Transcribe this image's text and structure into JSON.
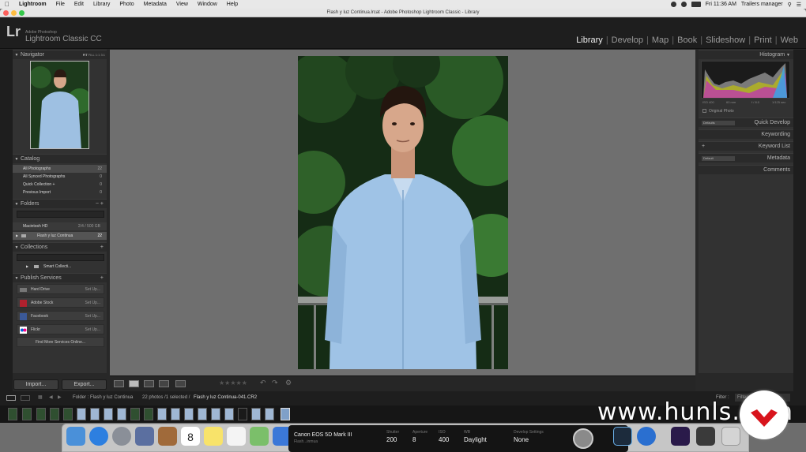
{
  "menubar": {
    "app": "Lightroom",
    "items": [
      "File",
      "Edit",
      "Library",
      "Photo",
      "Metadata",
      "View",
      "Window",
      "Help"
    ],
    "clock": "Fri 11:36 AM",
    "user": "Trailers manager"
  },
  "window": {
    "title": "Flash y luz Continua.lrcat - Adobe Photoshop Lightroom Classic - Library"
  },
  "identity": {
    "logo": "Lr",
    "sub1": "Adobe Photoshop",
    "sub2": "Lightroom Classic CC",
    "modules": [
      "Library",
      "Develop",
      "Map",
      "Book",
      "Slideshow",
      "Print",
      "Web"
    ],
    "active": "Library"
  },
  "left": {
    "navigator": {
      "title": "Navigator",
      "zoom": [
        "FIT",
        "FILL",
        "1:1",
        "3:1"
      ]
    },
    "catalog": {
      "title": "Catalog",
      "rows": [
        {
          "label": "All Photographs",
          "count": "22"
        },
        {
          "label": "All Synced Photographs",
          "count": "0"
        },
        {
          "label": "Quick Collection +",
          "count": "0"
        },
        {
          "label": "Previous Import",
          "count": "0"
        }
      ]
    },
    "folders": {
      "title": "Folders",
      "drive": "Macintosh HD",
      "drive_size": "2/4 / 500 GB",
      "folder": "Flash y luz Continua",
      "folder_count": "22"
    },
    "collections": {
      "title": "Collections",
      "item": "Smart Collecti..."
    },
    "publish": {
      "title": "Publish Services",
      "services": [
        {
          "name": "Hard Drive",
          "action": "Set Up..."
        },
        {
          "name": "Adobe Stock",
          "action": "Set Up..."
        },
        {
          "name": "Facebook",
          "action": "Set Up..."
        },
        {
          "name": "Flickr",
          "action": "Set Up..."
        }
      ],
      "find_more": "Find More Services Online..."
    },
    "import_btn": "Import...",
    "export_btn": "Export..."
  },
  "right": {
    "histogram": {
      "title": "Histogram",
      "iso": "ISO 400",
      "shutter": "60 mm",
      "aperture": "f / 8.0",
      "speed": "1/125 sec",
      "original": "Original Photo"
    },
    "panels": [
      {
        "preset": "Defaults",
        "title": "Quick Develop"
      },
      {
        "preset": "",
        "title": "Keywording"
      },
      {
        "preset": "",
        "title": "Keyword List"
      },
      {
        "preset": "Default",
        "title": "Metadata"
      },
      {
        "preset": "",
        "title": "Comments"
      }
    ]
  },
  "filmstrip": {
    "path_label": "Folder : Flash y luz Continua",
    "info": "22 photos /1 selected /",
    "filename": "Flash y luz Continua-041.CR2",
    "filter_label": "Filter :",
    "filter_value": "Filters Off"
  },
  "camera_bar": {
    "model": "Canon EOS 5D Mark III",
    "status": "Flash...inmua",
    "shutter_label": "Shutter",
    "shutter": "200",
    "aperture_label": "Aperture",
    "aperture": "8",
    "iso_label": "ISO",
    "iso": "400",
    "wb_label": "WB",
    "wb": "Daylight",
    "dev_label": "Develop Settings",
    "dev": "None"
  },
  "dock": {
    "calendar_day": "8"
  },
  "watermark": "www.hunls.com"
}
